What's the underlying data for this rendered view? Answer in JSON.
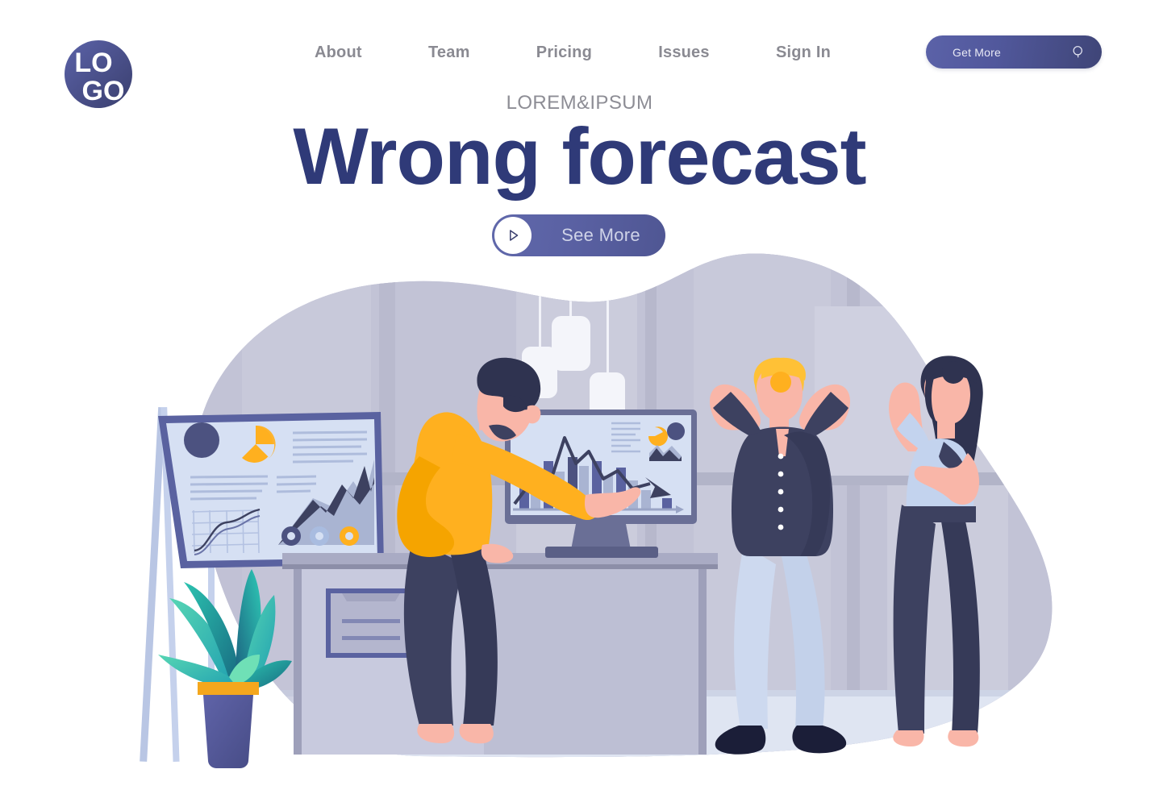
{
  "brand": {
    "logo_top": "LO",
    "logo_bottom": "GO",
    "logo_icon": "logo-circle-icon",
    "logo_color_light": "#5b62a8",
    "logo_color_dark": "#3f4577"
  },
  "nav": {
    "items": [
      {
        "label": "About"
      },
      {
        "label": "Team"
      },
      {
        "label": "Pricing"
      },
      {
        "label": "Issues"
      },
      {
        "label": "Sign In"
      }
    ]
  },
  "header": {
    "cta_label": "Get More",
    "cta_icon": "search-icon",
    "cta_gradient_from": "#5b62a8",
    "cta_gradient_to": "#3f4577"
  },
  "hero": {
    "eyebrow": "LOREM&IPSUM",
    "title": "Wrong forecast",
    "title_color": "#2f3a78",
    "eyebrow_color": "#8d8d95",
    "button_label": "See More",
    "button_icon": "play-icon",
    "button_gradient_from": "#6068ab",
    "button_gradient_to": "#4f5693"
  },
  "illustration": {
    "name": "office-team-wrong-forecast-scene",
    "blob_color": "#c9c9dd",
    "wall_color": "#c2c3d6",
    "wall_panel_color": "#cfd0e0",
    "floor_color": "#dfe5f2",
    "desk_color": "#a9abc4",
    "palette": {
      "orange": "#ffb01f",
      "orange_dark": "#f5a000",
      "navy": "#3d4160",
      "navy_deep": "#2f3350",
      "blue_slate": "#5a62a0",
      "light_blue": "#c3d2ee",
      "pale_board": "#d6e0f3",
      "skin": "#f9b6a8",
      "teal": "#2fbfae",
      "teal_dark": "#1b5d7d",
      "white": "#ffffff"
    },
    "objects": [
      {
        "name": "whiteboard-easel",
        "label": "presentation board on easel"
      },
      {
        "name": "desktop-monitor",
        "label": "monitor showing declining chart"
      },
      {
        "name": "office-desk",
        "label": "desk"
      },
      {
        "name": "drawer-cabinet",
        "label": "drawer unit"
      },
      {
        "name": "potted-plant",
        "label": "potted plant"
      },
      {
        "name": "pendant-lamps",
        "label": "three hanging pendant lamps"
      },
      {
        "name": "person-man-pointing",
        "label": "man in orange sweater pointing at screen"
      },
      {
        "name": "person-woman-blonde",
        "label": "blonde woman holding her head"
      },
      {
        "name": "person-woman-brunette",
        "label": "brunette woman with hand on head"
      }
    ]
  },
  "chart_data": [
    {
      "type": "bar",
      "name": "monitor-declining-bar-chart",
      "title": "",
      "categories": [
        "1",
        "2",
        "3",
        "4",
        "5",
        "6",
        "7",
        "8",
        "9",
        "10"
      ],
      "series": [
        {
          "name": "bars",
          "values": [
            38,
            52,
            60,
            72,
            66,
            58,
            50,
            40,
            24,
            12
          ]
        },
        {
          "name": "trend-line",
          "values": [
            55,
            95,
            70,
            82,
            60,
            46,
            38,
            30,
            18,
            8
          ]
        }
      ],
      "xlabel": "",
      "ylabel": "",
      "ylim": [
        0,
        100
      ],
      "grid": false,
      "annotations": [
        "down-arrow-end"
      ]
    },
    {
      "type": "pie",
      "name": "board-pie-chart",
      "labels": [
        "segment-a",
        "segment-b"
      ],
      "values": [
        72,
        28
      ],
      "colors": [
        "#ffb01f",
        "#d6e0f3"
      ]
    },
    {
      "type": "area",
      "name": "board-area-chart",
      "x": [
        0,
        1,
        2,
        3,
        4,
        5,
        6,
        7
      ],
      "series": [
        {
          "name": "front",
          "values": [
            5,
            25,
            32,
            30,
            52,
            40,
            70,
            58
          ]
        },
        {
          "name": "back",
          "values": [
            2,
            15,
            24,
            22,
            40,
            30,
            60,
            50
          ]
        }
      ],
      "colors": [
        "#3d4160",
        "#a9b4d2"
      ]
    },
    {
      "type": "line",
      "name": "board-s-curve-chart",
      "x": [
        0,
        1,
        2,
        3,
        4,
        5,
        6
      ],
      "series": [
        {
          "name": "curve-1",
          "values": [
            6,
            10,
            22,
            48,
            66,
            72,
            74
          ]
        },
        {
          "name": "curve-2",
          "values": [
            3,
            6,
            14,
            34,
            54,
            62,
            66
          ]
        }
      ],
      "grid": true
    }
  ]
}
